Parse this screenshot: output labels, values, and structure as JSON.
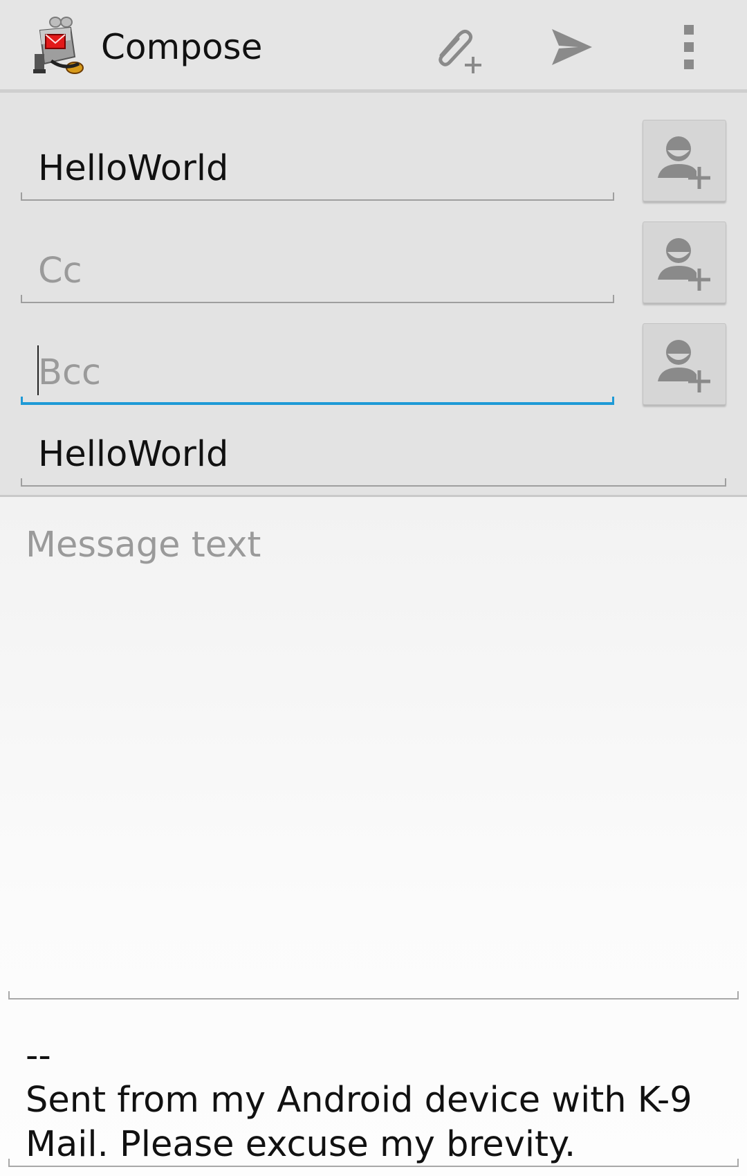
{
  "action_bar": {
    "title": "Compose",
    "icons": [
      "k9-mail-app-icon",
      "attach-icon",
      "send-icon",
      "overflow-menu-icon"
    ]
  },
  "fields": {
    "to": {
      "value": "HelloWorld"
    },
    "cc": {
      "placeholder": "Cc",
      "value": ""
    },
    "bcc": {
      "placeholder": "Bcc",
      "value": ""
    },
    "subject": {
      "value": "HelloWorld"
    }
  },
  "contact_buttons": {
    "icon": "add-contact-icon"
  },
  "message": {
    "placeholder": "Message text",
    "signature": "--\nSent from my Android device with K-9 Mail. Please excuse my brevity."
  },
  "colors": {
    "accent": "#1e9ad6",
    "action_bar_bg": "#e5e5e5",
    "fields_bg": "#e3e3e3",
    "icon_gray": "#8a8a8a"
  }
}
